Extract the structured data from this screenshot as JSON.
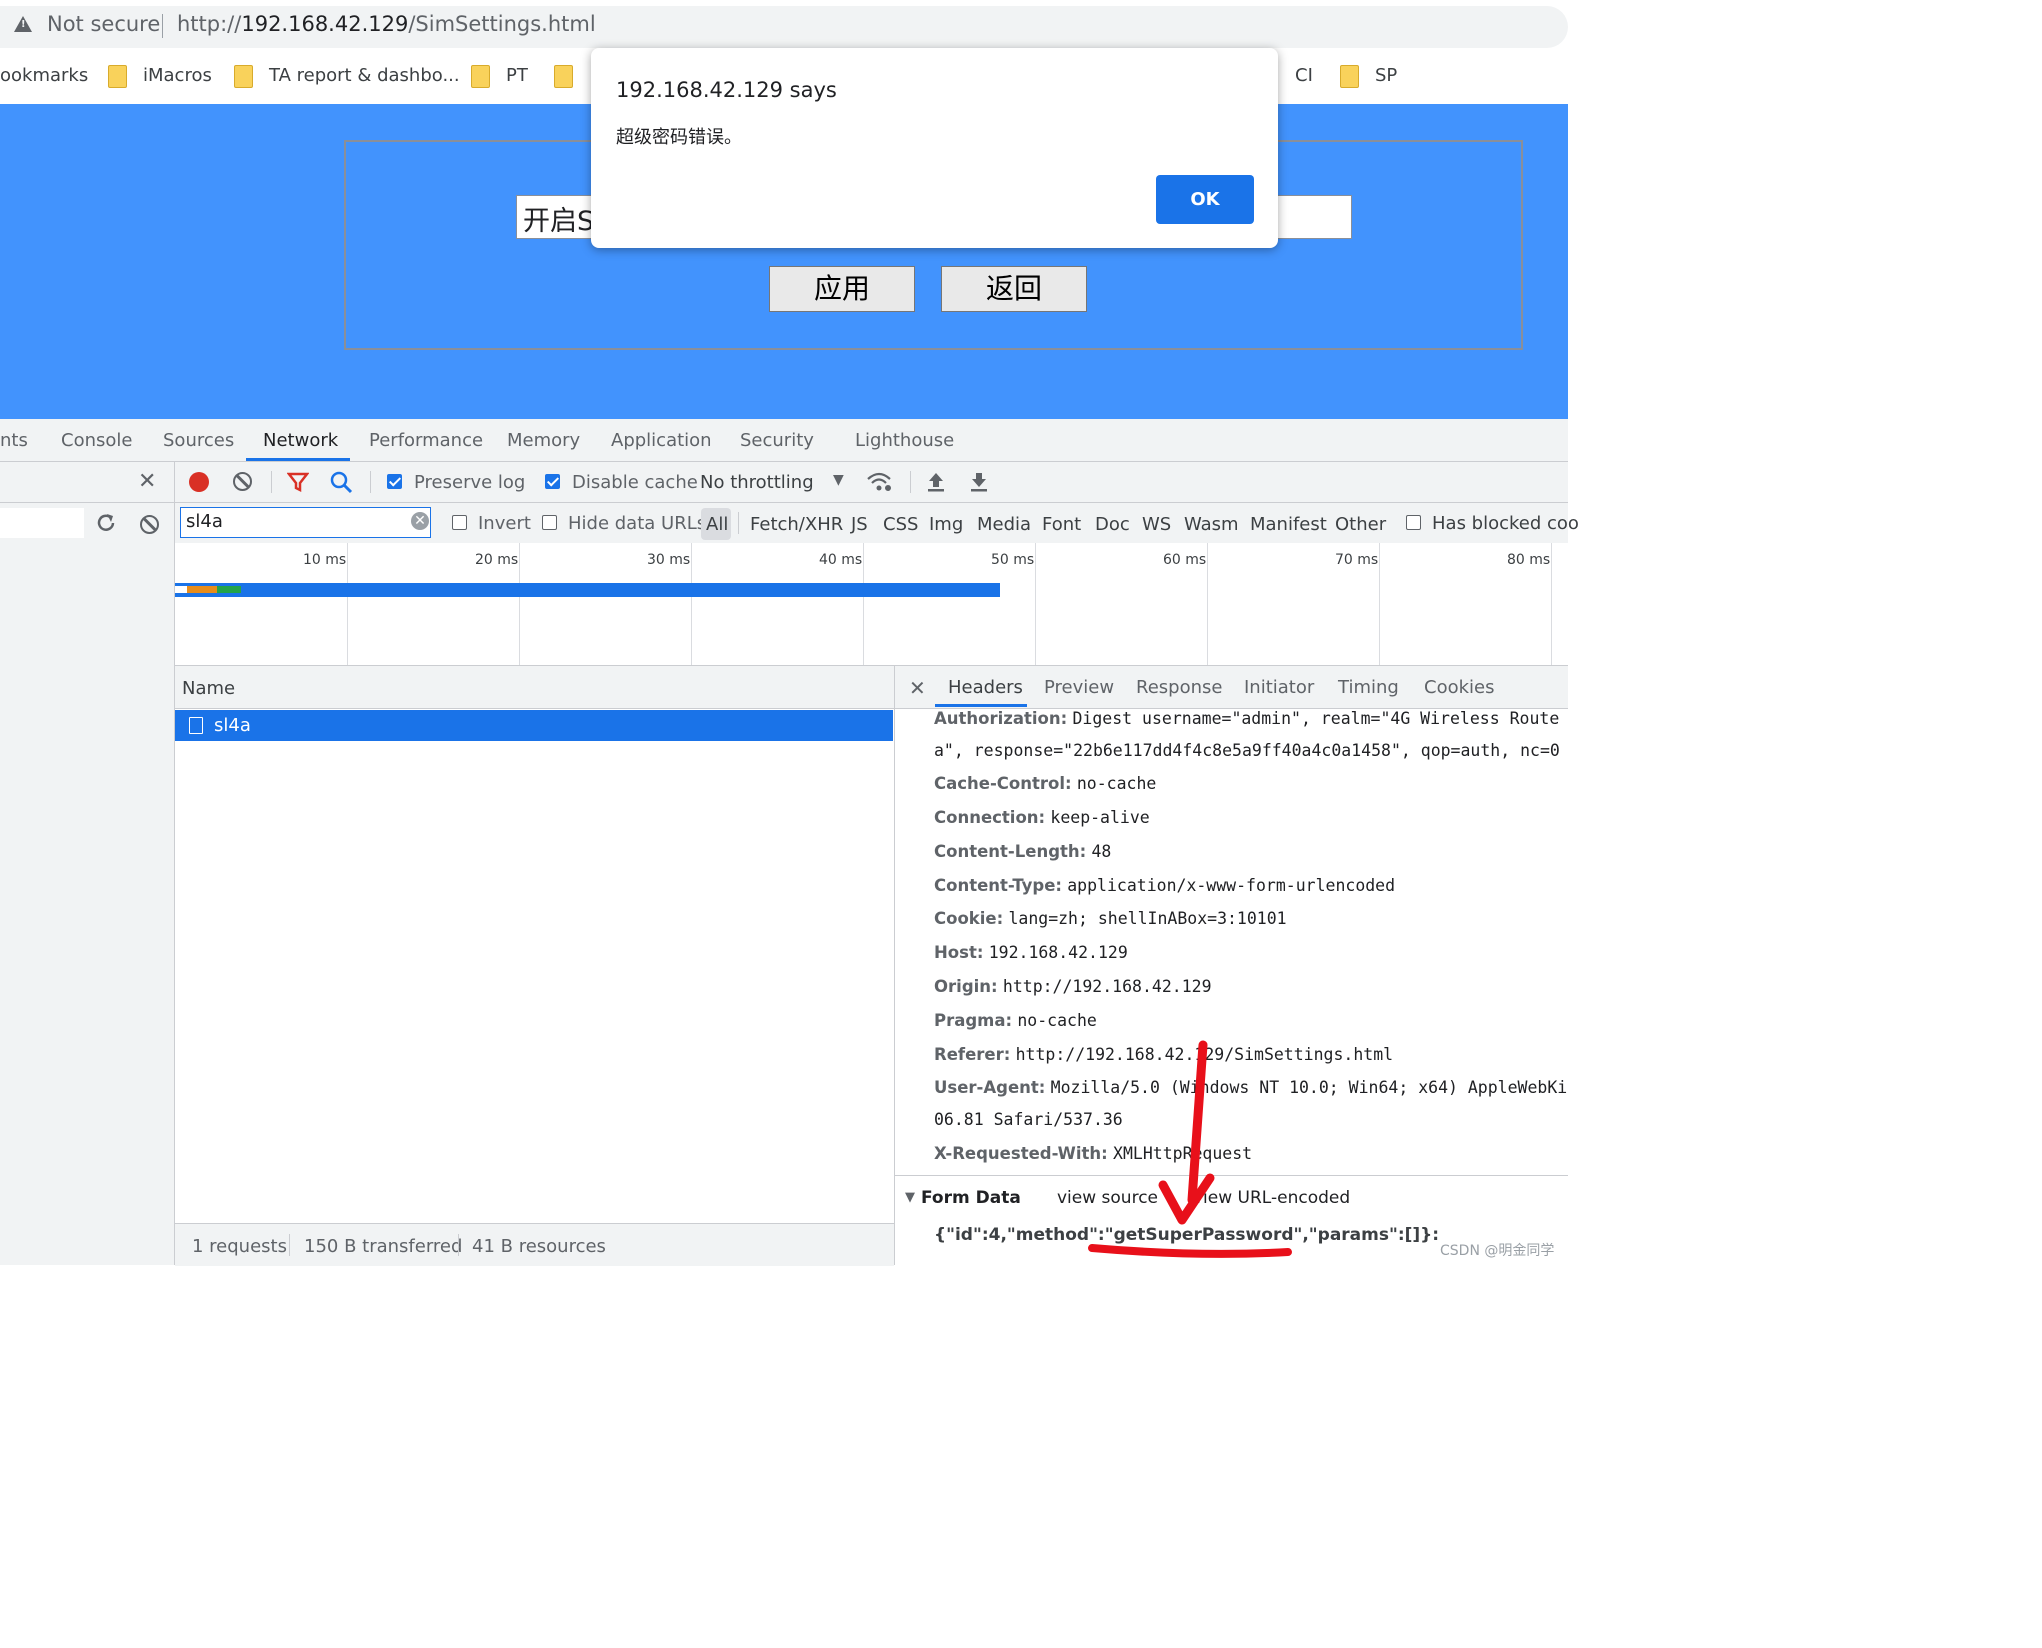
{
  "browser": {
    "security_label": "Not secure",
    "url_scheme": "http://",
    "url_host": "192.168.42.129",
    "url_path": "/SimSettings.html"
  },
  "bookmarks": [
    "ookmarks",
    "iMacros",
    "TA report & dashbo...",
    "PT",
    "CI",
    "SP"
  ],
  "page": {
    "input_value": "开启S",
    "apply_label": "应用",
    "back_label": "返回"
  },
  "dialog": {
    "title": "192.168.42.129 says",
    "message": "超级密码错误。",
    "ok_label": "OK"
  },
  "devtools": {
    "tabs": [
      "nts",
      "Console",
      "Sources",
      "Network",
      "Performance",
      "Memory",
      "Application",
      "Security",
      "Lighthouse"
    ],
    "active_tab": "Network",
    "toolbar": {
      "preserve_log": "Preserve log",
      "disable_cache": "Disable cache",
      "throttling": "No throttling"
    },
    "filter": {
      "value": "sl4a",
      "invert": "Invert",
      "hide_data_urls": "Hide data URLs",
      "types": [
        "All",
        "Fetch/XHR",
        "JS",
        "CSS",
        "Img",
        "Media",
        "Font",
        "Doc",
        "WS",
        "Wasm",
        "Manifest",
        "Other"
      ],
      "has_blocked": "Has blocked coo"
    },
    "timeline_labels": [
      "10 ms",
      "20 ms",
      "30 ms",
      "40 ms",
      "50 ms",
      "60 ms",
      "70 ms",
      "80 ms"
    ],
    "requests": {
      "column": "Name",
      "rows": [
        "sl4a"
      ]
    },
    "status": {
      "requests": "1 requests",
      "transferred": "150 B transferred",
      "resources": "41 B resources"
    },
    "details": {
      "tabs": [
        "Headers",
        "Preview",
        "Response",
        "Initiator",
        "Timing",
        "Cookies"
      ],
      "headers": [
        {
          "key": "Authorization:",
          "value": "Digest username=\"admin\", realm=\"4G Wireless Route"
        },
        {
          "key": "",
          "value": "a\", response=\"22b6e117dd4f4c8e5a9ff40a4c0a1458\", qop=auth, nc=0"
        },
        {
          "key": "Cache-Control:",
          "value": "no-cache"
        },
        {
          "key": "Connection:",
          "value": "keep-alive"
        },
        {
          "key": "Content-Length:",
          "value": "48"
        },
        {
          "key": "Content-Type:",
          "value": "application/x-www-form-urlencoded"
        },
        {
          "key": "Cookie:",
          "value": "lang=zh; shellInABox=3:10101"
        },
        {
          "key": "Host:",
          "value": "192.168.42.129"
        },
        {
          "key": "Origin:",
          "value": "http://192.168.42.129"
        },
        {
          "key": "Pragma:",
          "value": "no-cache"
        },
        {
          "key": "Referer:",
          "value": "http://192.168.42.129/SimSettings.html"
        },
        {
          "key": "User-Agent:",
          "value": "Mozilla/5.0 (Windows NT 10.0; Win64; x64) AppleWebKi"
        },
        {
          "key": "",
          "value": "06.81 Safari/537.36"
        },
        {
          "key": "X-Requested-With:",
          "value": "XMLHttpRequest"
        }
      ],
      "form_data": {
        "title": "Form Data",
        "view_source": "view source",
        "view_url_encoded": "view URL-encoded",
        "payload": "{\"id\":4,\"method\":\"getSuperPassword\",\"params\":[]}:"
      }
    }
  },
  "watermark": "CSDN @明金同学",
  "colors": {
    "page_blue": "#4293fd",
    "accent": "#1a73e8",
    "record_red": "#d93025",
    "annotation_red": "#e8101a"
  }
}
